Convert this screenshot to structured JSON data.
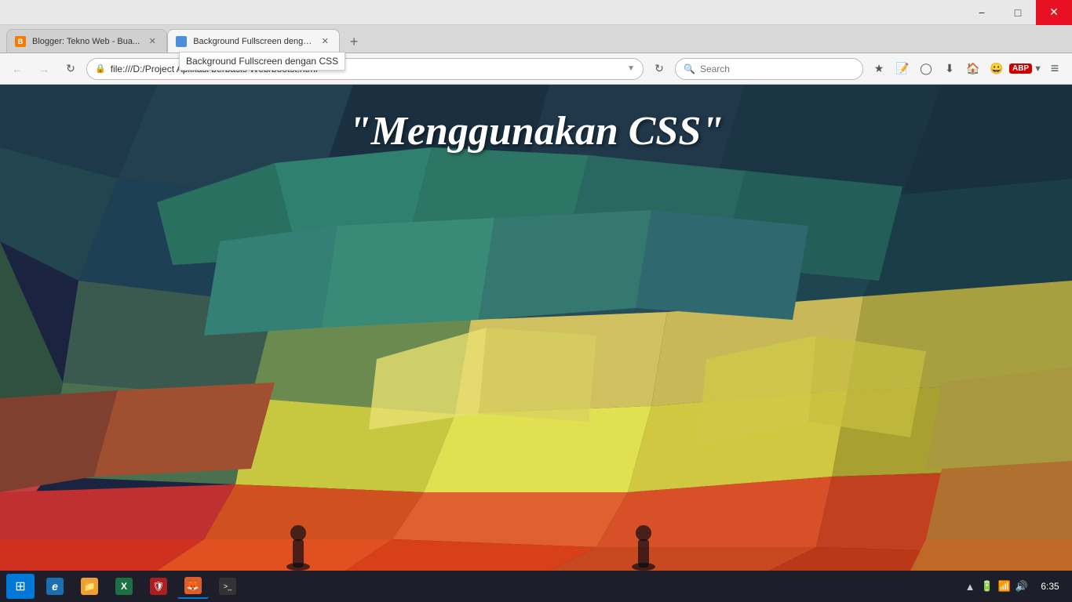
{
  "browser": {
    "title": "Firefox",
    "tabs": [
      {
        "id": "tab1",
        "label": "Blogger: Tekno Web - Bua...",
        "favicon_type": "blogger",
        "favicon_letter": "B",
        "active": false,
        "closeable": true
      },
      {
        "id": "tab2",
        "label": "Background Fullscreen denga...",
        "favicon_type": "file",
        "favicon_letter": "",
        "active": true,
        "closeable": true
      }
    ],
    "tab_tooltip": "Background Fullscreen dengan CSS",
    "new_tab_label": "+",
    "address": {
      "lock_icon": "🔒",
      "url": "file:///D:/Project Aplikasi berbasis Web/bootst",
      "url_suffix": ".html",
      "dropdown_icon": "▾",
      "refresh_icon": "↻"
    },
    "search": {
      "placeholder": "Search",
      "icon": "🔍"
    },
    "nav": {
      "back": "←",
      "forward": "→",
      "refresh": "↻",
      "home": "⌂"
    },
    "toolbar": {
      "bookmark_star": "☆",
      "reader": "📄",
      "pocket": "◉",
      "download": "⬇",
      "home": "🏠",
      "avatar": "😊",
      "abp": "ABP",
      "menu": "≡"
    }
  },
  "webpage": {
    "title": "\"Menggunakan CSS\""
  },
  "taskbar": {
    "start_icon": "⊞",
    "apps": [
      {
        "name": "IE",
        "type": "ie",
        "letter": "e",
        "active": false
      },
      {
        "name": "File Explorer",
        "type": "explorer",
        "letter": "📁",
        "active": false
      },
      {
        "name": "Excel",
        "type": "excel",
        "letter": "X",
        "active": false
      },
      {
        "name": "Security",
        "type": "security",
        "letter": "🛡",
        "active": false
      },
      {
        "name": "Firefox",
        "type": "firefox",
        "letter": "🦊",
        "active": true
      },
      {
        "name": "Terminal",
        "type": "terminal",
        "letter": ">_",
        "active": false
      }
    ],
    "sys_icons": [
      "▲",
      "🔋",
      "📶",
      "🔊"
    ],
    "time": "6:35"
  }
}
